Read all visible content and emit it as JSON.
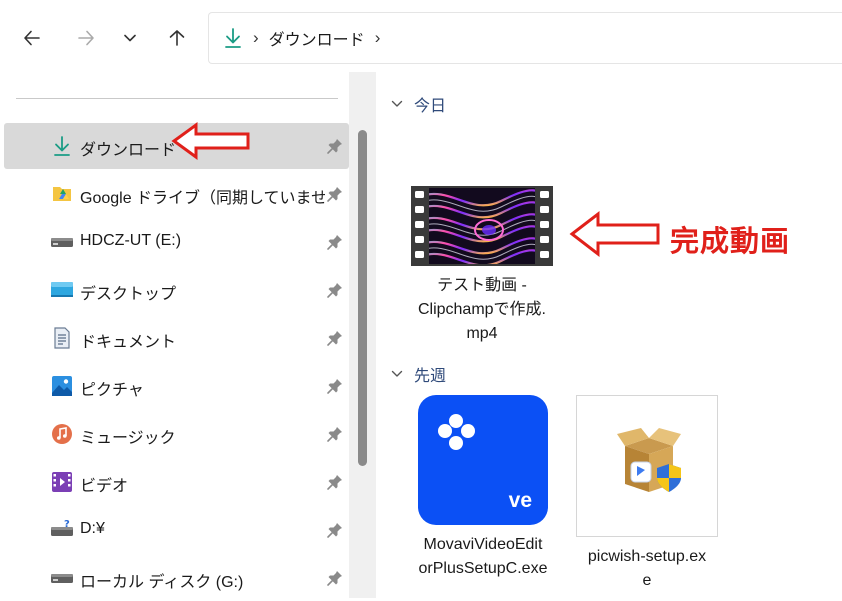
{
  "toolbar": {
    "back_icon": "arrow-left-icon",
    "forward_icon": "arrow-right-icon",
    "recent_icon": "chevron-down-icon",
    "up_icon": "arrow-up-icon"
  },
  "address_bar": {
    "location_icon": "download-icon",
    "crumb": "ダウンロード"
  },
  "sidebar": {
    "items": [
      {
        "label": "ダウンロード",
        "icon": "download-icon",
        "selected": true
      },
      {
        "label": "Google ドライブ（同期していません）",
        "icon": "google-drive-icon"
      },
      {
        "label": "HDCZ-UT (E:)",
        "icon": "drive-icon"
      },
      {
        "label": "デスクトップ",
        "icon": "desktop-icon"
      },
      {
        "label": "ドキュメント",
        "icon": "documents-icon"
      },
      {
        "label": "ピクチャ",
        "icon": "pictures-icon"
      },
      {
        "label": "ミュージック",
        "icon": "music-icon"
      },
      {
        "label": "ビデオ",
        "icon": "videos-icon"
      },
      {
        "label": "D:¥",
        "icon": "network-drive-icon"
      },
      {
        "label": "ローカル ディスク (G:)",
        "icon": "drive-icon"
      }
    ]
  },
  "content": {
    "groups": [
      {
        "header": "今日",
        "files": [
          {
            "name_lines": [
              "テスト動画 -",
              "Clipchampで作成.",
              "mp4"
            ],
            "icon": "video-thumbnail-icon"
          }
        ]
      },
      {
        "header": "先週",
        "files": [
          {
            "name_lines": [
              "MovaviVideoEdit",
              "orPlusSetupC.exe"
            ],
            "icon": "movavi-app-icon",
            "app_badge": "ve"
          },
          {
            "name_lines": [
              "picwish-setup.ex",
              "e"
            ],
            "icon": "installer-box-icon"
          }
        ]
      }
    ]
  },
  "annotation": {
    "label": "完成動画",
    "color": "#e0201a"
  }
}
